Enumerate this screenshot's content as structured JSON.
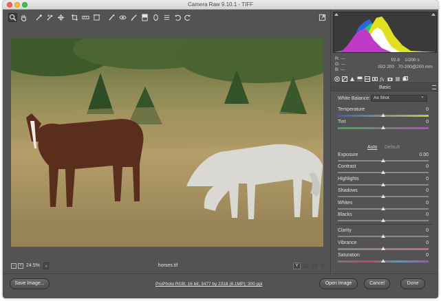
{
  "window": {
    "title": "Camera Raw 9.10.1  -  TIFF"
  },
  "toolbar": {
    "tools": [
      "zoom-tool",
      "hand-tool",
      "white-balance-tool",
      "color-sampler-tool",
      "targeted-adjustment-tool",
      "crop-tool",
      "straighten-tool",
      "transform-tool",
      "spot-removal-tool",
      "red-eye-tool",
      "adjustment-brush-tool",
      "graduated-filter-tool",
      "radial-filter-tool",
      "preferences",
      "rotate-ccw",
      "rotate-cw"
    ]
  },
  "image": {
    "filename": "horses.tif",
    "zoom": "24.5%"
  },
  "histogram": {
    "rgb": {
      "r": "R:",
      "g": "G:",
      "b": "B:",
      "r_val": "---",
      "g_val": "---",
      "b_val": "---"
    },
    "aperture": "f/2.8",
    "shutter": "1/200 s",
    "iso": "ISO 200",
    "lens": "70-200@200 mm"
  },
  "panel": {
    "section": "Basic",
    "white_balance_label": "White Balance:",
    "white_balance_value": "As Shot",
    "auto": "Auto",
    "default": "Default",
    "sliders": [
      {
        "label": "Temperature",
        "value": "0",
        "position": 0.5
      },
      {
        "label": "Tint",
        "value": "0",
        "position": 0.5
      },
      {
        "label": "Exposure",
        "value": "0.00",
        "position": 0.5
      },
      {
        "label": "Contrast",
        "value": "0",
        "position": 0.5
      },
      {
        "label": "Highlights",
        "value": "0",
        "position": 0.5
      },
      {
        "label": "Shadows",
        "value": "0",
        "position": 0.5
      },
      {
        "label": "Whites",
        "value": "0",
        "position": 0.5
      },
      {
        "label": "Blacks",
        "value": "0",
        "position": 0.5
      },
      {
        "label": "Clarity",
        "value": "0",
        "position": 0.5
      },
      {
        "label": "Vibrance",
        "value": "0",
        "position": 0.5
      },
      {
        "label": "Saturation",
        "value": "0",
        "position": 0.5
      }
    ]
  },
  "footer": {
    "save": "Save Image...",
    "workflow": "ProPhoto RGB; 16 bit; 3477 by 2318 (8.1MP); 300 ppi",
    "open": "Open Image",
    "cancel": "Cancel",
    "done": "Done"
  },
  "image_bar": {
    "zoom_minus": "−",
    "zoom_plus": "+",
    "zoom_dropdown": "⌄",
    "view_y": "Y"
  }
}
